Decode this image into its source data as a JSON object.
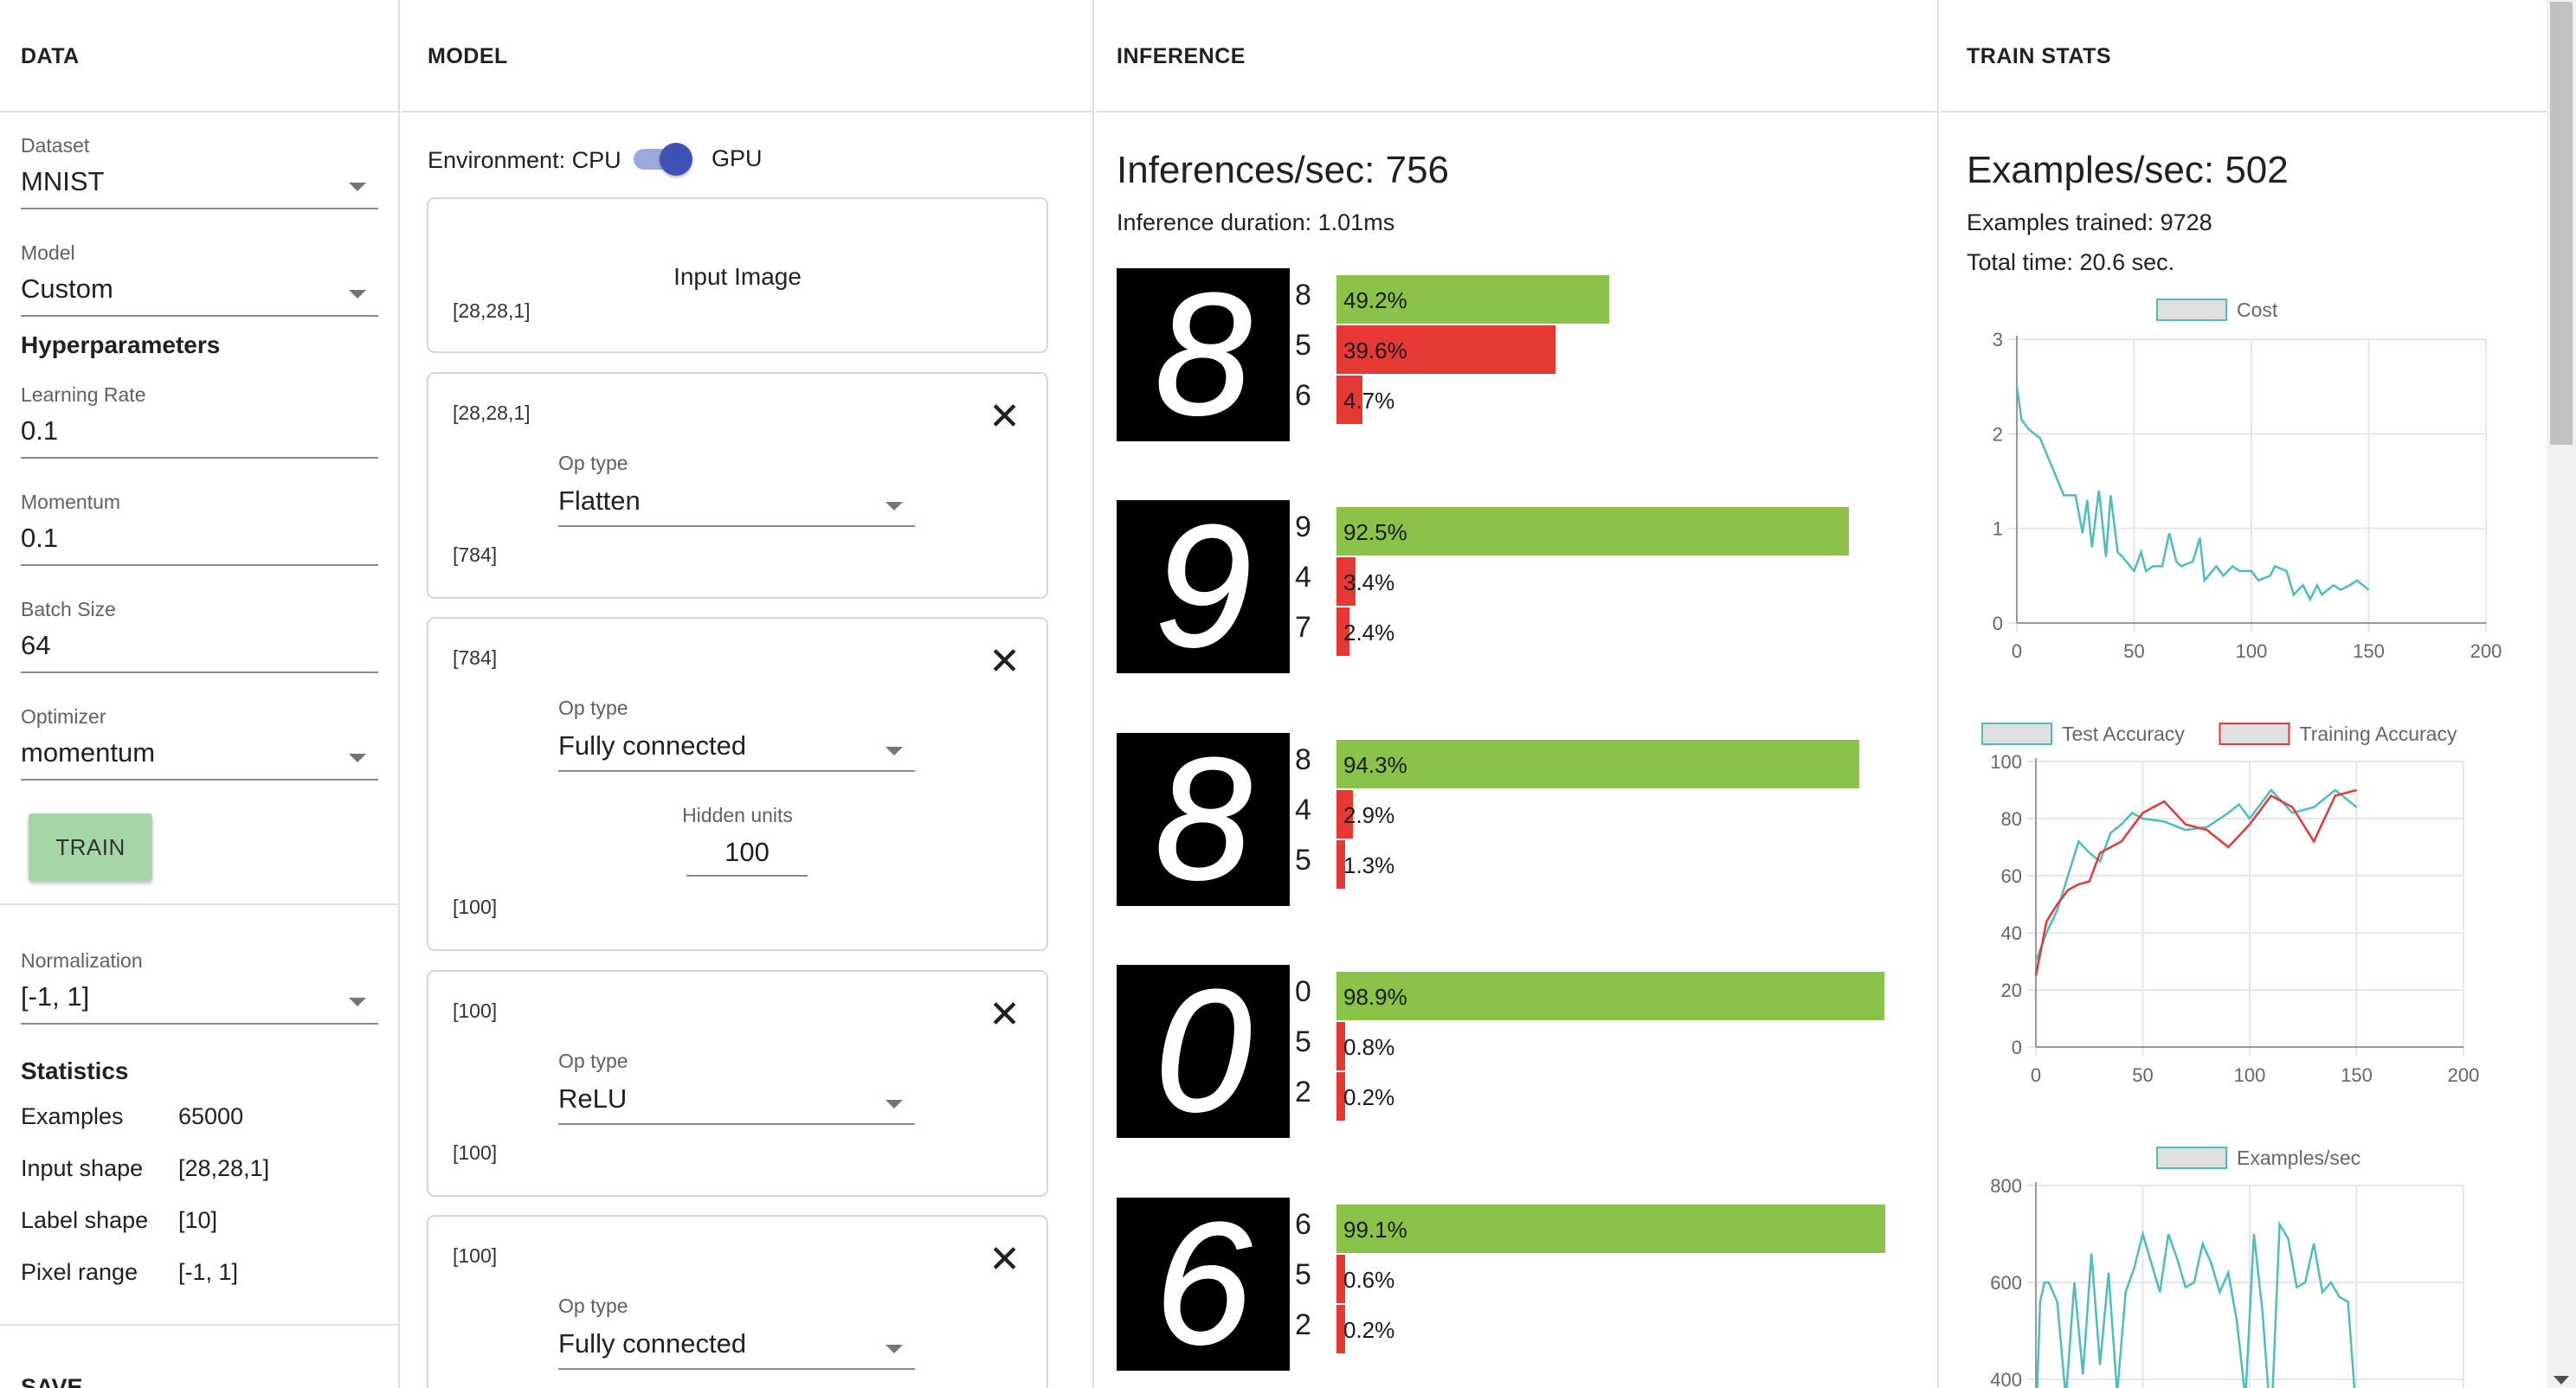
{
  "columns": {
    "data": "DATA",
    "model": "MODEL",
    "inference": "INFERENCE",
    "train_stats": "TRAIN STATS"
  },
  "data_panel": {
    "dataset": {
      "label": "Dataset",
      "value": "MNIST"
    },
    "model": {
      "label": "Model",
      "value": "Custom"
    },
    "hyperparameters_title": "Hyperparameters",
    "learning_rate": {
      "label": "Learning Rate",
      "value": "0.1"
    },
    "momentum": {
      "label": "Momentum",
      "value": "0.1"
    },
    "batch_size": {
      "label": "Batch Size",
      "value": "64"
    },
    "optimizer": {
      "label": "Optimizer",
      "value": "momentum"
    },
    "train_button": "TRAIN",
    "normalization": {
      "label": "Normalization",
      "value": "[-1, 1]"
    },
    "statistics_title": "Statistics",
    "statistics": [
      {
        "key": "Examples",
        "value": "65000"
      },
      {
        "key": "Input shape",
        "value": "[28,28,1]"
      },
      {
        "key": "Label shape",
        "value": "[10]"
      },
      {
        "key": "Pixel range",
        "value": "[-1, 1]"
      }
    ],
    "save_title": "SAVE"
  },
  "model_panel": {
    "environment_label": "Environment: CPU",
    "environment_alt": "GPU",
    "gpu_enabled": true,
    "input_card": {
      "title": "Input Image",
      "shape": "[28,28,1]"
    },
    "op_type_label": "Op type",
    "hidden_units_label": "Hidden units",
    "layers": [
      {
        "in_shape": "[28,28,1]",
        "op_type": "Flatten",
        "out_shape": "[784]"
      },
      {
        "in_shape": "[784]",
        "op_type": "Fully connected",
        "hidden_units": "100",
        "out_shape": "[100]"
      },
      {
        "in_shape": "[100]",
        "op_type": "ReLU",
        "out_shape": "[100]"
      },
      {
        "in_shape": "[100]",
        "op_type": "Fully connected"
      }
    ],
    "close_icon": "close-icon"
  },
  "inference_panel": {
    "inferences_per_sec": "Inferences/sec: 756",
    "duration": "Inference duration: 1.01ms",
    "colors": {
      "correct": "#8bc34a",
      "wrong": "#e53935"
    },
    "items": [
      {
        "digit": "8",
        "preds": [
          {
            "label": "8",
            "pct": "49.2%",
            "value": 49.2,
            "correct": true
          },
          {
            "label": "5",
            "pct": "39.6%",
            "value": 39.6,
            "correct": false
          },
          {
            "label": "6",
            "pct": "4.7%",
            "value": 4.7,
            "correct": false
          }
        ]
      },
      {
        "digit": "9",
        "preds": [
          {
            "label": "9",
            "pct": "92.5%",
            "value": 92.5,
            "correct": true
          },
          {
            "label": "4",
            "pct": "3.4%",
            "value": 3.4,
            "correct": false
          },
          {
            "label": "7",
            "pct": "2.4%",
            "value": 2.4,
            "correct": false
          }
        ]
      },
      {
        "digit": "8",
        "preds": [
          {
            "label": "8",
            "pct": "94.3%",
            "value": 94.3,
            "correct": true
          },
          {
            "label": "4",
            "pct": "2.9%",
            "value": 2.9,
            "correct": false
          },
          {
            "label": "5",
            "pct": "1.3%",
            "value": 1.3,
            "correct": false
          }
        ]
      },
      {
        "digit": "0",
        "preds": [
          {
            "label": "0",
            "pct": "98.9%",
            "value": 98.9,
            "correct": true
          },
          {
            "label": "5",
            "pct": "0.8%",
            "value": 0.8,
            "correct": false
          },
          {
            "label": "2",
            "pct": "0.2%",
            "value": 0.2,
            "correct": false
          }
        ]
      },
      {
        "digit": "6",
        "preds": [
          {
            "label": "6",
            "pct": "99.1%",
            "value": 99.1,
            "correct": true
          },
          {
            "label": "5",
            "pct": "0.6%",
            "value": 0.6,
            "correct": false
          },
          {
            "label": "2",
            "pct": "0.2%",
            "value": 0.2,
            "correct": false
          }
        ]
      }
    ]
  },
  "train_panel": {
    "examples_per_sec": "Examples/sec: 502",
    "examples_trained": "Examples trained: 9728",
    "total_time": "Total time: 20.6 sec."
  },
  "chart_data": [
    {
      "type": "line",
      "title": "",
      "legend": [
        "Cost"
      ],
      "legend_position": "top",
      "xlim": [
        0,
        200
      ],
      "ylim": [
        0,
        3
      ],
      "xticks": [
        "0",
        "50",
        "100",
        "150",
        "200"
      ],
      "yticks": [
        "0",
        "1",
        "2",
        "3"
      ],
      "grid": true,
      "series": [
        {
          "name": "Cost",
          "color": "#4dbdbd",
          "x": [
            0,
            2,
            5,
            10,
            15,
            20,
            25,
            28,
            30,
            32,
            35,
            38,
            40,
            43,
            45,
            50,
            53,
            55,
            58,
            62,
            65,
            68,
            70,
            75,
            78,
            80,
            85,
            88,
            92,
            95,
            100,
            103,
            108,
            110,
            115,
            118,
            122,
            125,
            128,
            130,
            135,
            138,
            142,
            145,
            150
          ],
          "y": [
            2.5,
            2.15,
            2.05,
            1.95,
            1.65,
            1.35,
            1.35,
            0.95,
            1.3,
            0.8,
            1.4,
            0.7,
            1.35,
            0.75,
            0.7,
            0.55,
            0.75,
            0.55,
            0.6,
            0.6,
            0.95,
            0.65,
            0.6,
            0.65,
            0.9,
            0.45,
            0.6,
            0.5,
            0.6,
            0.55,
            0.55,
            0.45,
            0.5,
            0.6,
            0.55,
            0.3,
            0.4,
            0.25,
            0.4,
            0.3,
            0.4,
            0.35,
            0.4,
            0.45,
            0.35
          ]
        }
      ]
    },
    {
      "type": "line",
      "title": "",
      "legend": [
        "Test Accuracy",
        "Training Accuracy"
      ],
      "legend_position": "top",
      "xlim": [
        0,
        200
      ],
      "ylim": [
        0,
        100
      ],
      "xticks": [
        "0",
        "50",
        "100",
        "150",
        "200"
      ],
      "yticks": [
        "0",
        "20",
        "40",
        "60",
        "80",
        "100"
      ],
      "grid": true,
      "series": [
        {
          "name": "Test Accuracy",
          "color": "#4dbdbd",
          "x": [
            0,
            5,
            10,
            15,
            20,
            25,
            30,
            35,
            40,
            45,
            50,
            60,
            70,
            80,
            90,
            95,
            100,
            110,
            120,
            130,
            140,
            150
          ],
          "y": [
            30,
            40,
            48,
            60,
            72,
            68,
            65,
            75,
            78,
            82,
            80,
            79,
            76,
            77,
            82,
            85,
            80,
            90,
            82,
            84,
            90,
            84
          ]
        },
        {
          "name": "Training Accuracy",
          "color": "#e53935",
          "x": [
            0,
            5,
            10,
            15,
            20,
            25,
            30,
            40,
            50,
            60,
            70,
            80,
            90,
            100,
            110,
            120,
            130,
            140,
            150
          ],
          "y": [
            25,
            44,
            50,
            55,
            57,
            58,
            68,
            72,
            82,
            86,
            78,
            76,
            70,
            78,
            88,
            84,
            72,
            88,
            90
          ]
        }
      ]
    },
    {
      "type": "line",
      "title": "",
      "legend": [
        "Examples/sec"
      ],
      "legend_position": "top",
      "xlim": [
        0,
        200
      ],
      "ylim": [
        300,
        800
      ],
      "yticks": [
        "400",
        "600",
        "800"
      ],
      "grid": true,
      "series": [
        {
          "name": "Examples/sec",
          "color": "#4dbdbd",
          "x": [
            0,
            2,
            4,
            6,
            10,
            14,
            18,
            22,
            26,
            30,
            34,
            38,
            42,
            46,
            50,
            54,
            58,
            62,
            66,
            70,
            74,
            78,
            82,
            86,
            90,
            94,
            98,
            102,
            106,
            110,
            114,
            118,
            122,
            126,
            130,
            134,
            138,
            142,
            146,
            150
          ],
          "y": [
            300,
            560,
            600,
            600,
            560,
            360,
            600,
            410,
            660,
            430,
            620,
            370,
            580,
            630,
            700,
            640,
            580,
            700,
            650,
            590,
            600,
            680,
            640,
            580,
            620,
            520,
            360,
            700,
            540,
            300,
            720,
            690,
            590,
            600,
            680,
            580,
            600,
            570,
            560,
            320
          ]
        }
      ]
    }
  ]
}
